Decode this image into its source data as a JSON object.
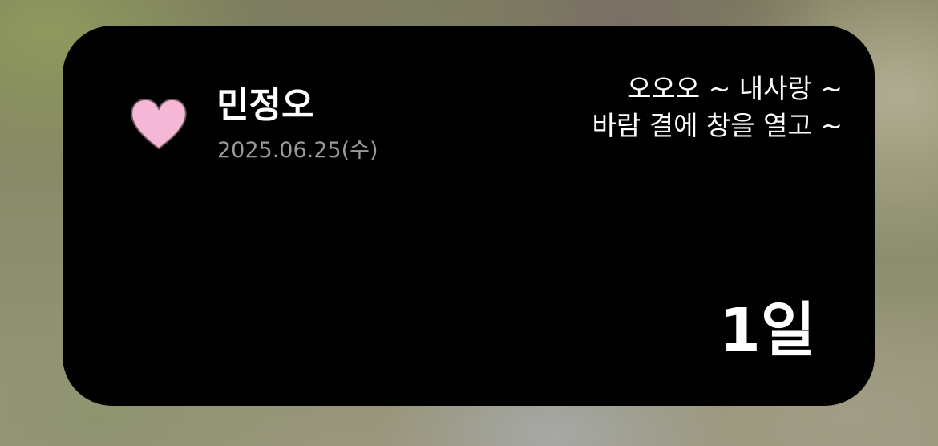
{
  "widget": {
    "icon": "heart-icon",
    "icon_color": "#f4b8d6",
    "name": "민정오",
    "date": "2025.06.25(수)",
    "lyrics": [
      "오오오 ~ 내사랑 ~",
      "바람 결에 창을 열고 ~"
    ],
    "days_count": "1일"
  }
}
